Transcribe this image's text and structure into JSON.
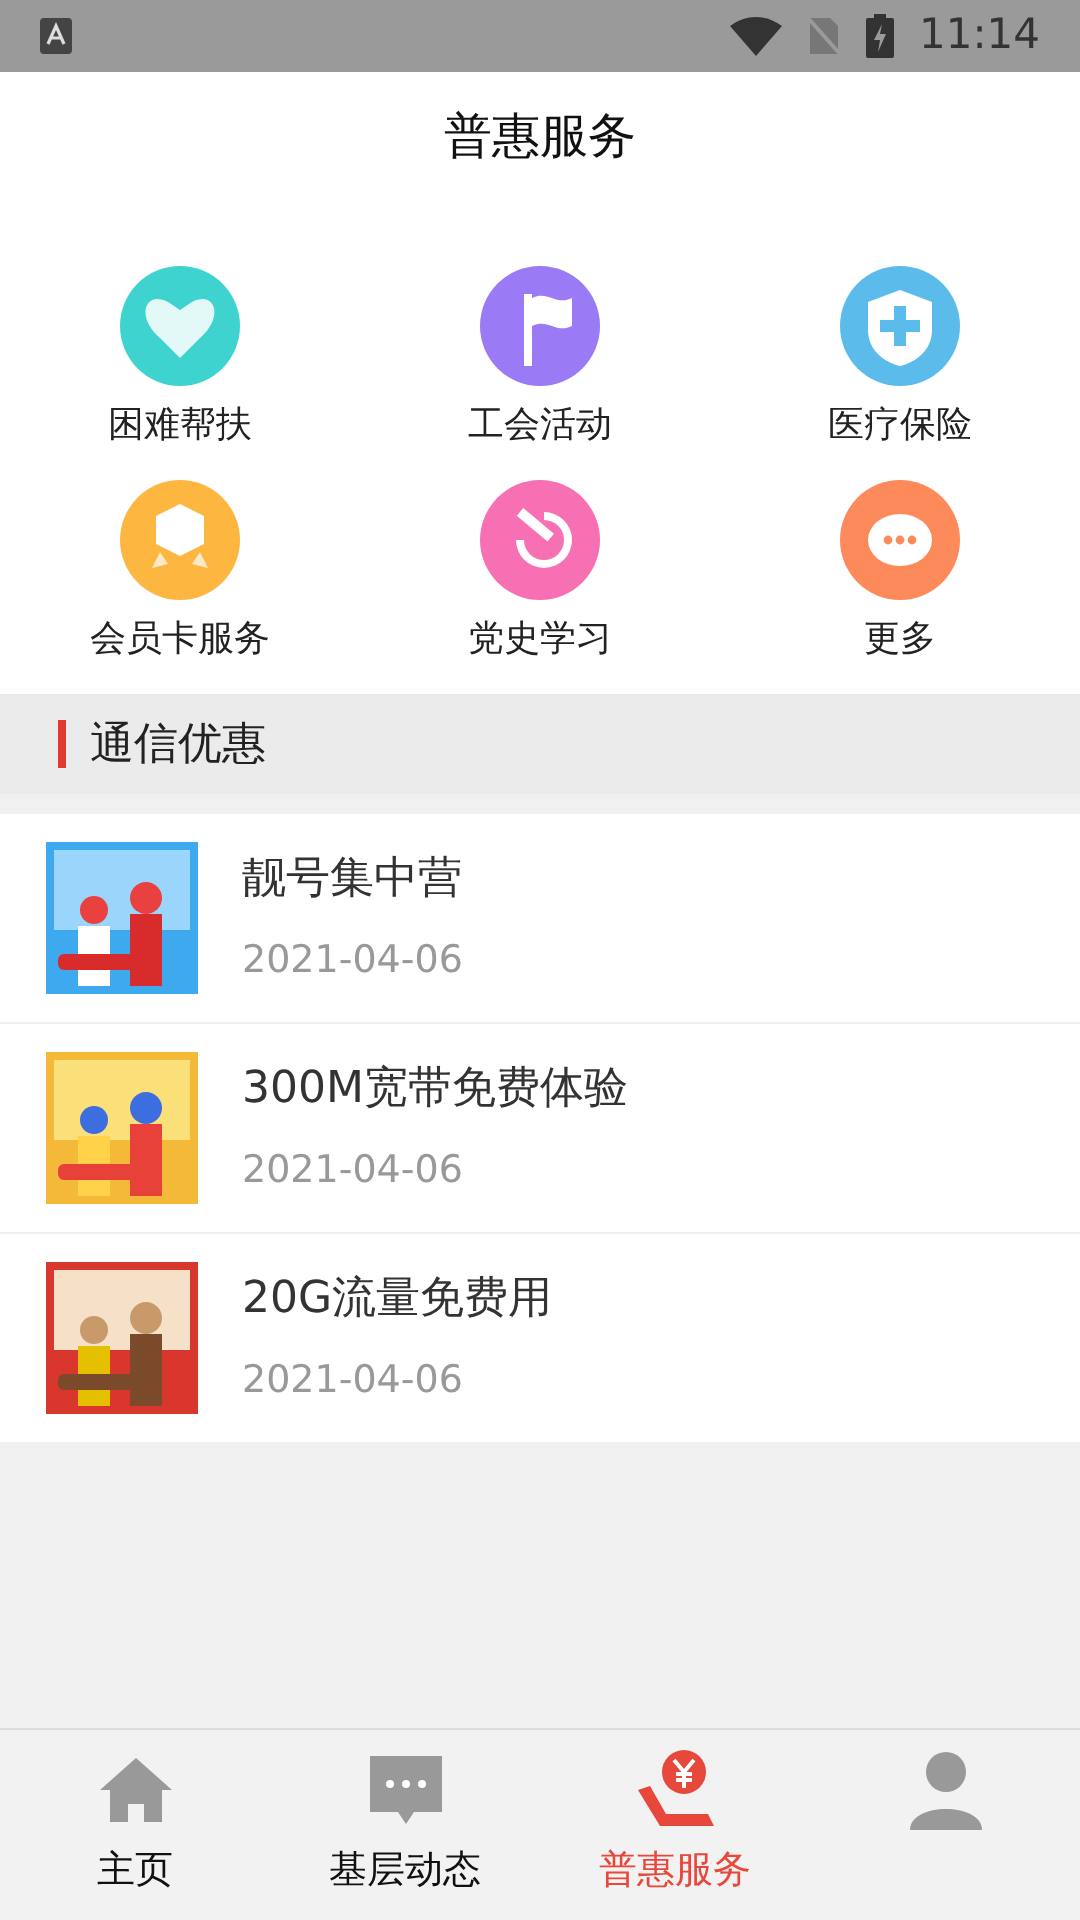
{
  "status_bar": {
    "time": "11:14"
  },
  "header": {
    "title": "普惠服务"
  },
  "services": [
    {
      "label": "困难帮扶",
      "kind": "heart",
      "color": "#3fd3cf"
    },
    {
      "label": "工会活动",
      "kind": "flag",
      "color": "#9b7af5"
    },
    {
      "label": "医疗保险",
      "kind": "shield",
      "color": "#5bbcec"
    },
    {
      "label": "会员卡服务",
      "kind": "badge",
      "color": "#fdb640"
    },
    {
      "label": "党史学习",
      "kind": "party",
      "color": "#f770b4"
    },
    {
      "label": "更多",
      "kind": "more",
      "color": "#fd8a5a"
    }
  ],
  "section": {
    "title": "通信优惠"
  },
  "articles": [
    {
      "title": "靓号集中营",
      "date": "2021-04-06",
      "kind": "picture"
    },
    {
      "title": "300M宽带免费体验",
      "date": "2021-04-06",
      "kind": "picture"
    },
    {
      "title": "20G流量免费用",
      "date": "2021-04-06",
      "kind": "picture"
    }
  ],
  "tabs": [
    {
      "label": "主页",
      "kind": "home",
      "selected": false
    },
    {
      "label": "基层动态",
      "kind": "chat",
      "selected": false
    },
    {
      "label": "普惠服务",
      "kind": "money",
      "selected": true
    },
    {
      "kind": "person",
      "selected": false
    }
  ]
}
